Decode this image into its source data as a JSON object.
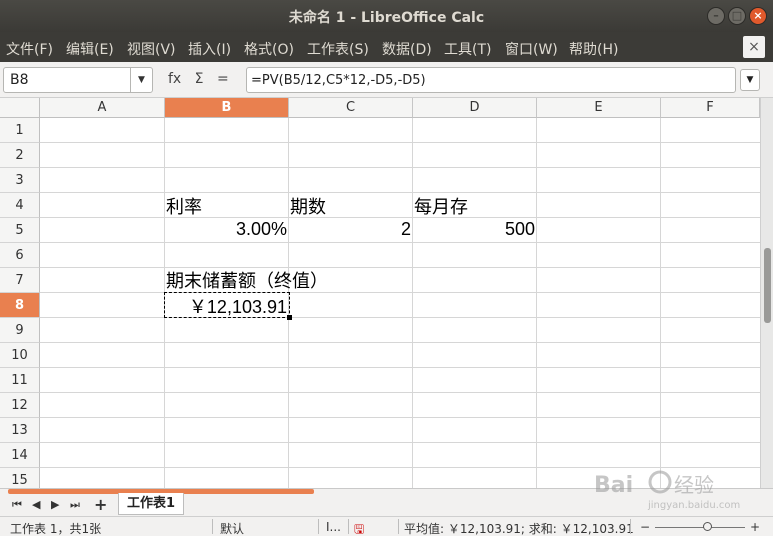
{
  "window": {
    "title": "未命名 1 - LibreOffice Calc",
    "buttons": [
      "minimize-icon",
      "maximize-icon",
      "close-icon"
    ]
  },
  "menubar": {
    "items": [
      "文件(F)",
      "编辑(E)",
      "视图(V)",
      "插入(I)",
      "格式(O)",
      "工作表(S)",
      "数据(D)",
      "工具(T)",
      "窗口(W)",
      "帮助(H)"
    ],
    "close_doc": "×"
  },
  "formulabar": {
    "name_box": "B8",
    "fx": "fx",
    "sum": "Σ",
    "equals": "=",
    "formula": "=PV(B5/12,C5*12,-D5,-D5)"
  },
  "sheet": {
    "columns": [
      "A",
      "B",
      "C",
      "D",
      "E",
      "F"
    ],
    "active_column": "B",
    "rows": [
      "1",
      "2",
      "3",
      "4",
      "5",
      "6",
      "7",
      "8",
      "9",
      "10",
      "11",
      "12",
      "13",
      "14",
      "15"
    ],
    "active_row": "8",
    "cells": {
      "B4": "利率",
      "C4": "期数",
      "D4": "每月存",
      "B5": "3.00%",
      "C5": "2",
      "D5": "500",
      "B7": "期末储蓄额（终值）",
      "B8": "￥12,103.91"
    }
  },
  "tabs": {
    "sheet_name": "工作表1",
    "add": "+"
  },
  "statusbar": {
    "sheet_info": "工作表 1，共1张",
    "page_style": "默认",
    "insert_mode": "I...",
    "summary": "平均值: ￥12,103.91; 求和: ￥12,103.91",
    "zoom_minus": "−",
    "zoom_plus": "+"
  },
  "colors": {
    "accent": "#e9804f",
    "titlebar": "#3c3b37",
    "close_button": "#e0592c"
  }
}
